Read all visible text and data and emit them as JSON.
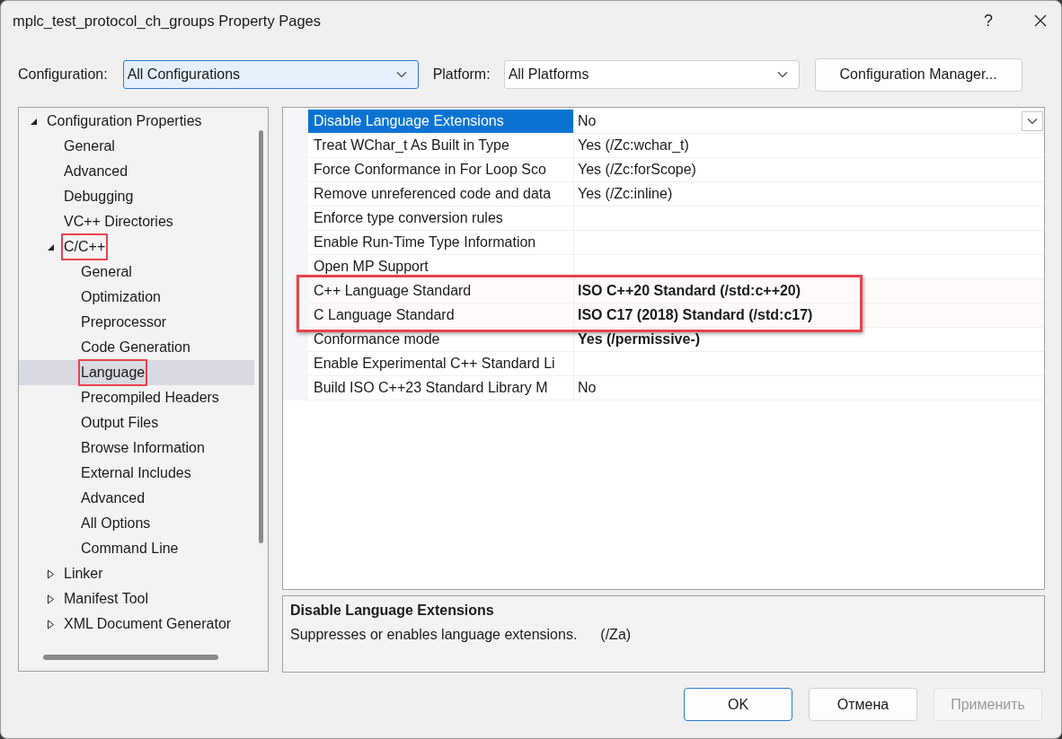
{
  "window": {
    "title": "mplc_test_protocol_ch_groups Property Pages",
    "help_button": "?"
  },
  "configuration": {
    "label": "Configuration:",
    "value": "All Configurations",
    "focused": true
  },
  "platform": {
    "label": "Platform:",
    "value": "All Platforms",
    "focused": false
  },
  "config_manager_button": "Configuration Manager...",
  "tree": [
    {
      "label": "Configuration Properties",
      "expanded": true,
      "selected": false,
      "highlighted": false,
      "children": [
        {
          "label": "General",
          "selected": false,
          "highlighted": false
        },
        {
          "label": "Advanced",
          "selected": false,
          "highlighted": false
        },
        {
          "label": "Debugging",
          "selected": false,
          "highlighted": false
        },
        {
          "label": "VC++ Directories",
          "selected": false,
          "highlighted": false
        },
        {
          "label": "C/C++",
          "expanded": true,
          "selected": false,
          "highlighted": true,
          "children": [
            {
              "label": "General",
              "selected": false,
              "highlighted": false
            },
            {
              "label": "Optimization",
              "selected": false,
              "highlighted": false
            },
            {
              "label": "Preprocessor",
              "selected": false,
              "highlighted": false
            },
            {
              "label": "Code Generation",
              "selected": false,
              "highlighted": false
            },
            {
              "label": "Language",
              "selected": true,
              "highlighted": true
            },
            {
              "label": "Precompiled Headers",
              "selected": false,
              "highlighted": false
            },
            {
              "label": "Output Files",
              "selected": false,
              "highlighted": false
            },
            {
              "label": "Browse Information",
              "selected": false,
              "highlighted": false
            },
            {
              "label": "External Includes",
              "selected": false,
              "highlighted": false
            },
            {
              "label": "Advanced",
              "selected": false,
              "highlighted": false
            },
            {
              "label": "All Options",
              "selected": false,
              "highlighted": false
            },
            {
              "label": "Command Line",
              "selected": false,
              "highlighted": false
            }
          ]
        },
        {
          "label": "Linker",
          "expanded": false,
          "selected": false,
          "highlighted": false
        },
        {
          "label": "Manifest Tool",
          "expanded": false,
          "selected": false,
          "highlighted": false
        },
        {
          "label": "XML Document Generator",
          "expanded": false,
          "selected": false,
          "highlighted": false
        }
      ]
    }
  ],
  "properties": [
    {
      "name": "Disable Language Extensions",
      "value": "No",
      "selected": true,
      "modified": false,
      "highlighted": false
    },
    {
      "name": "Treat WChar_t As Built in Type",
      "value": "Yes (/Zc:wchar_t)",
      "selected": false,
      "modified": false,
      "highlighted": false
    },
    {
      "name": "Force Conformance in For Loop Sco",
      "value": "Yes (/Zc:forScope)",
      "selected": false,
      "modified": false,
      "highlighted": false
    },
    {
      "name": "Remove unreferenced code and data",
      "value": "Yes (/Zc:inline)",
      "selected": false,
      "modified": false,
      "highlighted": false
    },
    {
      "name": "Enforce type conversion rules",
      "selected": false,
      "modified": false,
      "highlighted": false
    },
    {
      "name": "Enable Run-Time Type Information",
      "selected": false,
      "modified": false,
      "highlighted": false
    },
    {
      "name": "Open MP Support",
      "selected": false,
      "modified": false,
      "highlighted": false
    },
    {
      "name": "C++ Language Standard",
      "value": "ISO C++20 Standard (/std:c++20)",
      "selected": false,
      "modified": true,
      "highlighted": true
    },
    {
      "name": "C Language Standard",
      "value": "ISO C17 (2018) Standard (/std:c17)",
      "selected": false,
      "modified": true,
      "highlighted": true
    },
    {
      "name": "Conformance mode",
      "value": "Yes (/permissive-)",
      "selected": false,
      "modified": true,
      "highlighted": false
    },
    {
      "name": "Enable Experimental C++ Standard Li",
      "selected": false,
      "modified": false,
      "highlighted": false
    },
    {
      "name": "Build ISO C++23 Standard Library M",
      "value": "No",
      "selected": false,
      "modified": false,
      "highlighted": false
    }
  ],
  "description": {
    "title": "Disable Language Extensions",
    "text": "Suppresses or enables language extensions.",
    "switch": "(/Za)"
  },
  "buttons": [
    {
      "label": "OK",
      "kind": "default",
      "disabled": false
    },
    {
      "label": "Отмена",
      "kind": "normal",
      "disabled": false
    },
    {
      "label": "Применить",
      "kind": "normal",
      "disabled": true
    }
  ]
}
